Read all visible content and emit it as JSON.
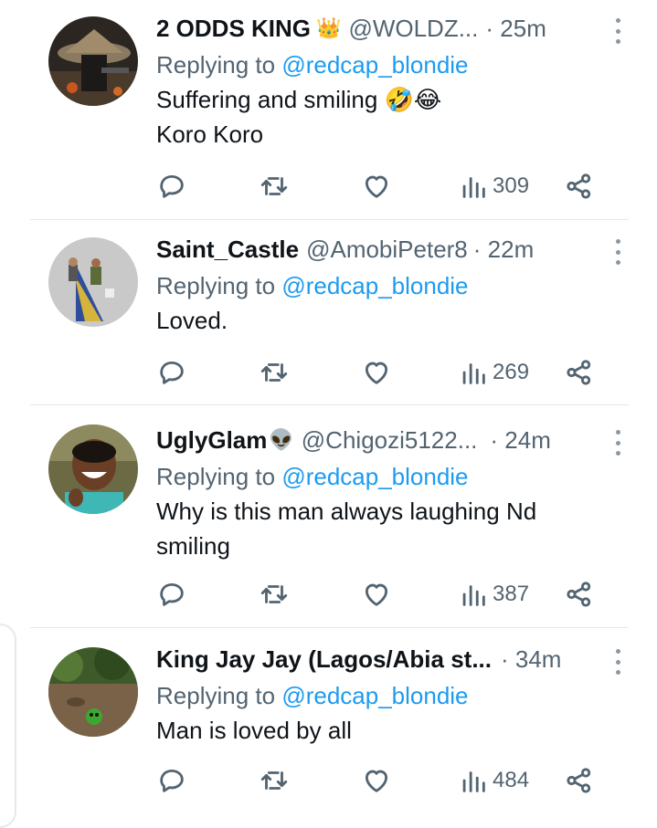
{
  "replies": [
    {
      "name": "2 ODDS KING",
      "name_emoji": "👑",
      "handle": "@WOLDZ...",
      "time": "· 25m",
      "replying_prefix": "Replying to ",
      "replying_to": "@redcap_blondie",
      "text_lines": [
        "Suffering and smiling 🤣😂",
        "Koro Koro"
      ],
      "views": "309"
    },
    {
      "name": "Saint_Castle",
      "name_emoji": "",
      "handle": "@AmobiPeter8",
      "time": "· 22m",
      "replying_prefix": "Replying to ",
      "replying_to": "@redcap_blondie",
      "text_lines": [
        "Loved."
      ],
      "views": "269"
    },
    {
      "name": "UglyGlam",
      "name_emoji": "👽",
      "handle": "@Chigozi5122...",
      "time": "· 24m",
      "replying_prefix": "Replying to ",
      "replying_to": "@redcap_blondie",
      "text_lines": [
        "Why is this man always laughing Nd",
        "smiling"
      ],
      "views": "387"
    },
    {
      "name": "King Jay Jay (Lagos/Abia st...",
      "name_emoji": "",
      "handle": "",
      "time": "· 34m",
      "replying_prefix": "Replying to ",
      "replying_to": "@redcap_blondie",
      "text_lines": [
        "Man is loved by all"
      ],
      "views": "484"
    }
  ],
  "icons": {
    "reply": "reply-icon",
    "retweet": "retweet-icon",
    "like": "heart-icon",
    "views": "views-icon",
    "share": "share-icon",
    "more": "more-icon"
  },
  "colors": {
    "link": "#1d9bf0",
    "secondary_text": "#536471",
    "primary_text": "#0f1419"
  }
}
